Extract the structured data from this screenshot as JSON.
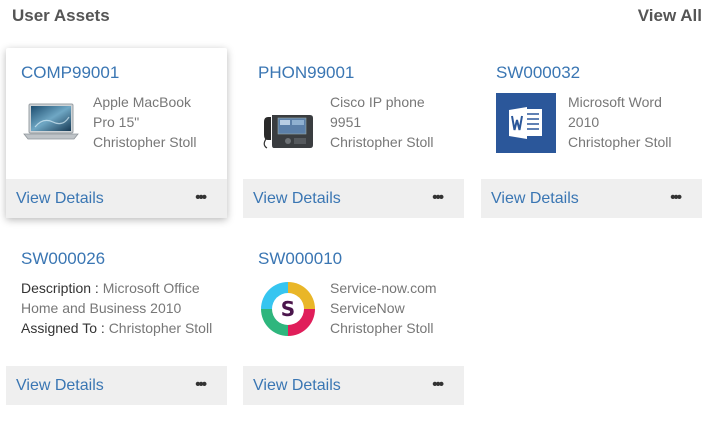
{
  "header": {
    "title": "User Assets",
    "view_all": "View All"
  },
  "footer": {
    "view_details": "View Details",
    "more": "•••"
  },
  "cards": [
    {
      "id": "COMP99001",
      "icon": "laptop-icon",
      "lines": [
        "Apple MacBook",
        "Pro 15\"",
        "Christopher Stoll"
      ]
    },
    {
      "id": "PHON99001",
      "icon": "ip-phone-icon",
      "lines": [
        "Cisco IP phone",
        "9951",
        "Christopher Stoll"
      ]
    },
    {
      "id": "SW000032",
      "icon": "word-icon",
      "lines": [
        "Microsoft Word",
        "2010",
        "Christopher Stoll"
      ]
    },
    {
      "id": "SW000026",
      "desc_label": "Description : ",
      "desc_value": "Microsoft Office",
      "desc_value2": "Home and Business 2010",
      "assigned_label": "Assigned To : ",
      "assigned_value": "Christopher Stoll"
    },
    {
      "id": "SW000010",
      "icon": "servicenow-slack-icon",
      "lines": [
        "Service-now.com",
        "ServiceNow",
        "Christopher Stoll"
      ]
    }
  ],
  "colors": {
    "link": "#3a76b3",
    "footer_bg": "#efefef",
    "text_muted": "#777777",
    "word_blue": "#2b579a"
  }
}
